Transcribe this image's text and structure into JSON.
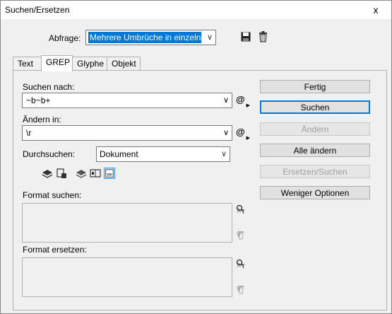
{
  "window": {
    "title": "Suchen/Ersetzen",
    "close_glyph": "x"
  },
  "query": {
    "label": "Abfrage:",
    "value": "Mehrere Umbrüche in einzelne"
  },
  "tabs": [
    {
      "label": "Text",
      "active": false
    },
    {
      "label": "GREP",
      "active": true
    },
    {
      "label": "Glyphe",
      "active": false
    },
    {
      "label": "Objekt",
      "active": false
    }
  ],
  "find": {
    "label": "Suchen nach:",
    "value": "~b~b+",
    "special_glyph": "@"
  },
  "change": {
    "label": "Ändern in:",
    "value": "\\r",
    "special_glyph": "@"
  },
  "scope": {
    "label": "Durchsuchen:",
    "value": "Dokument"
  },
  "options_icons": [
    "locked-layers-icon",
    "locked-stories-icon",
    "hidden-layers-icon",
    "master-pages-icon",
    "footnotes-icon"
  ],
  "format_find": {
    "label": "Format suchen:"
  },
  "format_change": {
    "label": "Format ersetzen:"
  },
  "buttons": {
    "done": "Fertig",
    "find": "Suchen",
    "change": "Ändern",
    "change_all": "Alle ändern",
    "change_find": "Ersetzen/Suchen",
    "fewer_options": "Weniger Optionen"
  },
  "colors": {
    "selection": "#0078d7",
    "default_button_border": "#0078d7",
    "disabled_text": "#a0a0a0"
  }
}
